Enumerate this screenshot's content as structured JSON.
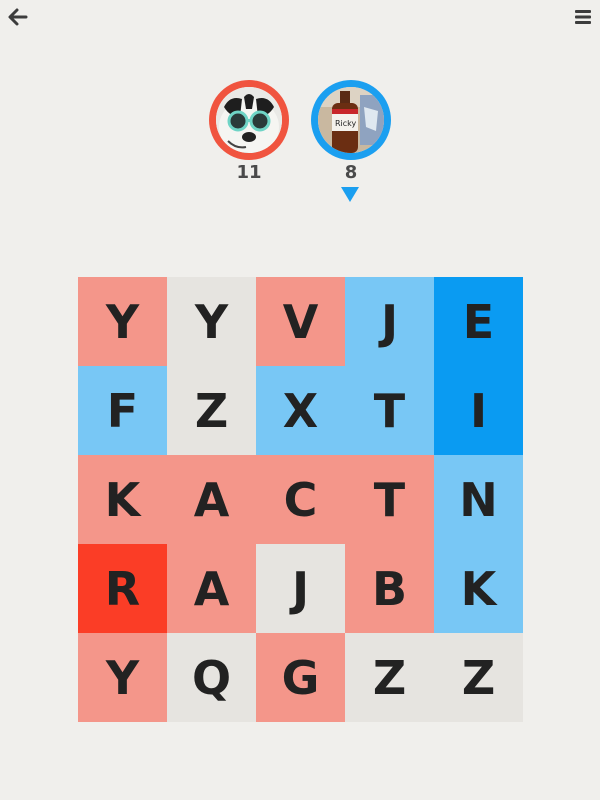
{
  "header": {
    "back_icon": "arrow-left-icon",
    "menu_icon": "hamburger-menu-icon"
  },
  "players": [
    {
      "score": "11",
      "color": "#f0543f",
      "avatar": "dog-with-sunglasses"
    },
    {
      "score": "8",
      "color": "#1b9ff0",
      "avatar": "bottle-labeled-ricky",
      "avatar_label": "Ricky"
    }
  ],
  "turn": {
    "current_player": 2,
    "indicator_icon": "triangle-down-icon"
  },
  "colors": {
    "neutral": "#e6e4e0",
    "red_light": "#f4968a",
    "red_dark": "#fb3d26",
    "blue_light": "#78c7f5",
    "blue_dark": "#0a9bf2",
    "letter": "#222222"
  },
  "board": {
    "rows": [
      [
        {
          "letter": "Y",
          "state": "red-light"
        },
        {
          "letter": "Y",
          "state": "neutral"
        },
        {
          "letter": "V",
          "state": "red-light"
        },
        {
          "letter": "J",
          "state": "blue-light"
        },
        {
          "letter": "E",
          "state": "blue-dark"
        }
      ],
      [
        {
          "letter": "F",
          "state": "blue-light"
        },
        {
          "letter": "Z",
          "state": "neutral"
        },
        {
          "letter": "X",
          "state": "blue-light"
        },
        {
          "letter": "T",
          "state": "blue-light"
        },
        {
          "letter": "I",
          "state": "blue-dark"
        }
      ],
      [
        {
          "letter": "K",
          "state": "red-light"
        },
        {
          "letter": "A",
          "state": "red-light"
        },
        {
          "letter": "C",
          "state": "red-light"
        },
        {
          "letter": "T",
          "state": "red-light"
        },
        {
          "letter": "N",
          "state": "blue-light"
        }
      ],
      [
        {
          "letter": "R",
          "state": "red-dark"
        },
        {
          "letter": "A",
          "state": "red-light"
        },
        {
          "letter": "J",
          "state": "neutral"
        },
        {
          "letter": "B",
          "state": "red-light"
        },
        {
          "letter": "K",
          "state": "blue-light"
        }
      ],
      [
        {
          "letter": "Y",
          "state": "red-light"
        },
        {
          "letter": "Q",
          "state": "neutral"
        },
        {
          "letter": "G",
          "state": "red-light"
        },
        {
          "letter": "Z",
          "state": "neutral"
        },
        {
          "letter": "Z",
          "state": "neutral"
        }
      ]
    ]
  }
}
